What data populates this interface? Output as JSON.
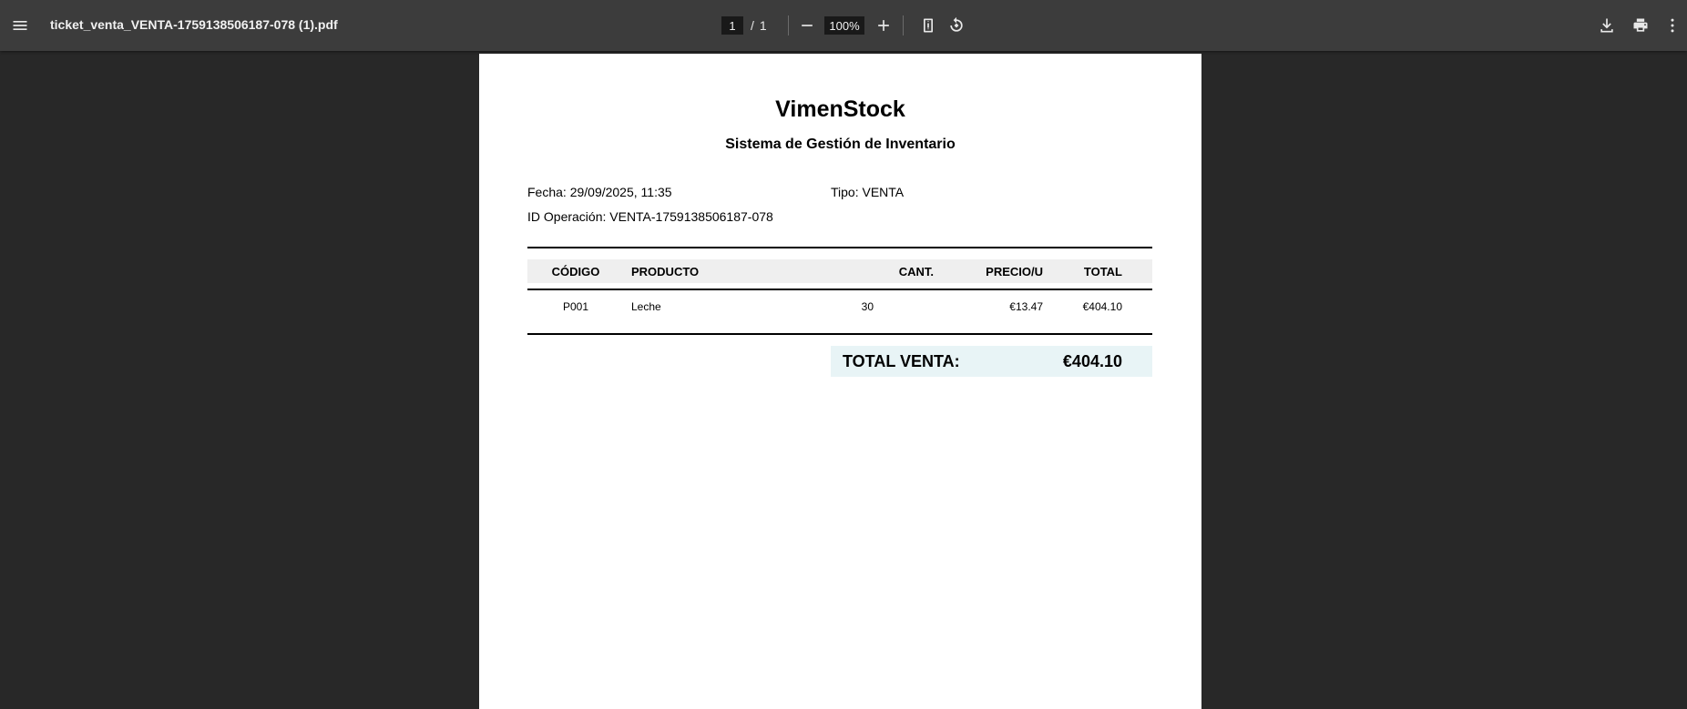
{
  "toolbar": {
    "filename": "ticket_venta_VENTA-1759138506187-078 (1).pdf",
    "page_current": "1",
    "page_separator": "/",
    "page_total": "1",
    "zoom": "100%",
    "icons": {
      "menu": "menu-icon",
      "zoom_out": "minus-icon",
      "zoom_in": "plus-icon",
      "fit_page": "fit-to-page-icon",
      "rotate": "rotate-icon",
      "download": "download-icon",
      "print": "print-icon",
      "more": "more-vertical-icon"
    },
    "colors": {
      "bar": "#3c3c3c",
      "background": "#282828"
    }
  },
  "ticket": {
    "title": "VimenStock",
    "subtitle": "Sistema de Gestión de Inventario",
    "fecha": "Fecha: 29/09/2025, 11:35",
    "tipo": "Tipo: VENTA",
    "id_operacion": "ID Operación: VENTA-1759138506187-078",
    "columns": {
      "codigo": "CÓDIGO",
      "producto": "PRODUCTO",
      "cant": "CANT.",
      "precio": "PRECIO/U",
      "total": "TOTAL"
    },
    "rows": [
      {
        "codigo": "P001",
        "producto": "Leche",
        "cant": "30",
        "precio": "€13.47",
        "total": "€404.10"
      }
    ],
    "total_label": "TOTAL VENTA:",
    "total_value": "€404.10",
    "colors": {
      "header_bg": "#efefef",
      "total_bg": "#e8f4f6"
    }
  }
}
